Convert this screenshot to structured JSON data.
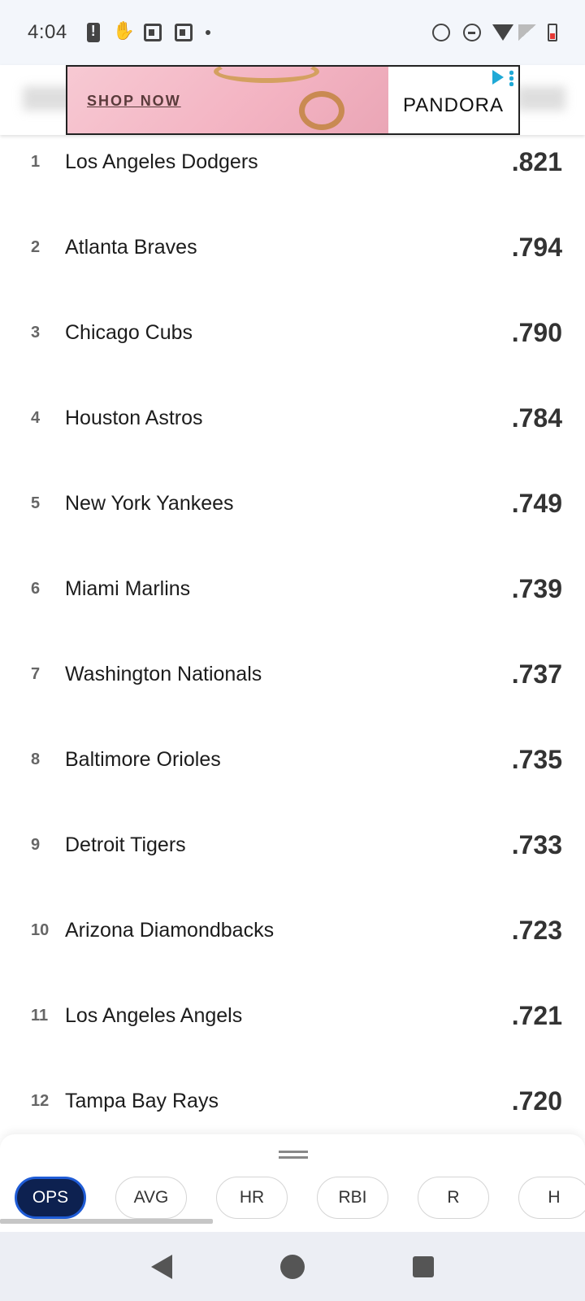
{
  "status_bar": {
    "time": "4:04"
  },
  "ad": {
    "cta": "SHOP NOW",
    "brand": "PANDORA"
  },
  "rankings": [
    {
      "rank": "1",
      "team": "Los Angeles Dodgers",
      "value": ".821"
    },
    {
      "rank": "2",
      "team": "Atlanta Braves",
      "value": ".794"
    },
    {
      "rank": "3",
      "team": "Chicago Cubs",
      "value": ".790"
    },
    {
      "rank": "4",
      "team": "Houston Astros",
      "value": ".784"
    },
    {
      "rank": "5",
      "team": "New York Yankees",
      "value": ".749"
    },
    {
      "rank": "6",
      "team": "Miami Marlins",
      "value": ".739"
    },
    {
      "rank": "7",
      "team": "Washington Nationals",
      "value": ".737"
    },
    {
      "rank": "8",
      "team": "Baltimore Orioles",
      "value": ".735"
    },
    {
      "rank": "9",
      "team": "Detroit Tigers",
      "value": ".733"
    },
    {
      "rank": "10",
      "team": "Arizona Diamondbacks",
      "value": ".723"
    },
    {
      "rank": "11",
      "team": "Los Angeles Angels",
      "value": ".721"
    },
    {
      "rank": "12",
      "team": "Tampa Bay Rays",
      "value": ".720"
    }
  ],
  "stat_chips": [
    {
      "label": "OPS",
      "active": true
    },
    {
      "label": "AVG",
      "active": false
    },
    {
      "label": "HR",
      "active": false
    },
    {
      "label": "RBI",
      "active": false
    },
    {
      "label": "R",
      "active": false
    },
    {
      "label": "H",
      "active": false
    }
  ],
  "colors": {
    "active_chip_bg": "#0d2150",
    "active_chip_border": "#1f5cd6",
    "status_bar_bg": "#f3f6fb",
    "nav_bar_bg": "#eceef4"
  }
}
